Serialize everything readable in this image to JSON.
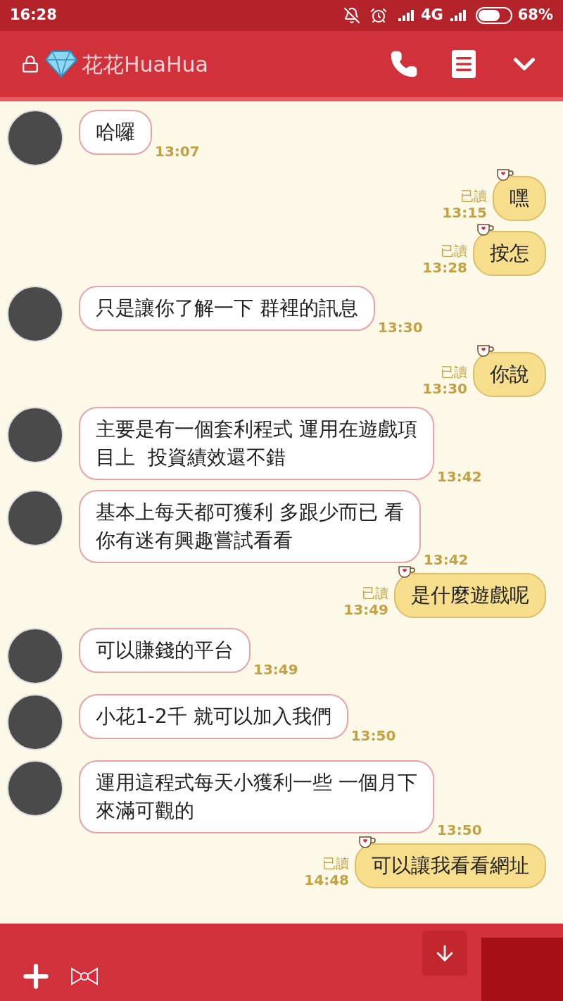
{
  "status_bar": {
    "time": "16:28",
    "network": "4G",
    "battery": "68%"
  },
  "header": {
    "title": "花花HuaHua"
  },
  "messages": [
    {
      "kind": "incoming",
      "lines": [
        "哈囉"
      ],
      "time": "13:07"
    },
    {
      "kind": "outgoing",
      "text": "嘿",
      "time": "13:15",
      "read": "已讀"
    },
    {
      "kind": "outgoing",
      "text": "按怎",
      "time": "13:28",
      "read": "已讀"
    },
    {
      "kind": "incoming",
      "lines": [
        "只是讓你了解一下 群裡的訊息"
      ],
      "time": "13:30"
    },
    {
      "kind": "outgoing",
      "text": "你說",
      "time": "13:30",
      "read": "已讀"
    },
    {
      "kind": "incoming",
      "lines": [
        "主要是有一個套利程式 運用在遊戲項",
        "目上  投資績效還不錯"
      ],
      "time": "13:42"
    },
    {
      "kind": "incoming",
      "lines": [
        "基本上每天都可獲利 多跟少而已 看",
        "你有迷有興趣嘗試看看"
      ],
      "time": "13:42"
    },
    {
      "kind": "outgoing",
      "text": "是什麼遊戲呢",
      "time": "13:49",
      "read": "已讀"
    },
    {
      "kind": "incoming",
      "lines": [
        "可以賺錢的平台"
      ],
      "time": "13:49"
    },
    {
      "kind": "incoming",
      "lines": [
        "小花1-2千 就可以加入我們"
      ],
      "time": "13:50"
    },
    {
      "kind": "incoming",
      "lines": [
        "運用這程式每天小獲利一些 一個月下",
        "來滿可觀的"
      ],
      "time": "13:50"
    },
    {
      "kind": "outgoing",
      "text": "可以讓我看看網址",
      "time": "14:48",
      "read": "已讀"
    }
  ]
}
